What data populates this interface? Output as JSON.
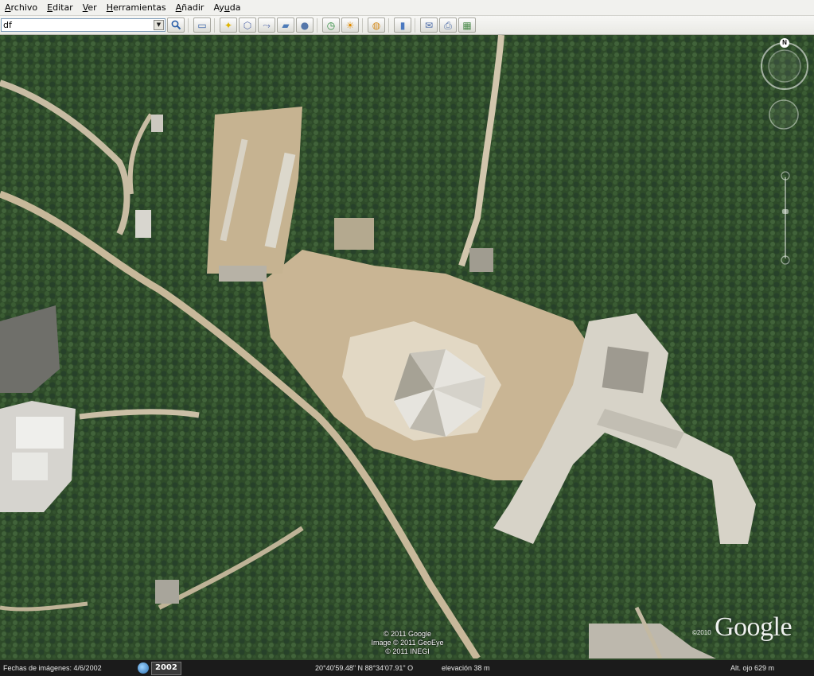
{
  "menu": {
    "items": [
      {
        "label": "Archivo",
        "mnemonic": "A"
      },
      {
        "label": "Editar",
        "mnemonic": "E"
      },
      {
        "label": "Ver",
        "mnemonic": "V"
      },
      {
        "label": "Herramientas",
        "mnemonic": "H"
      },
      {
        "label": "Añadir",
        "mnemonic": "A"
      },
      {
        "label": "Ayuda",
        "mnemonic": "u"
      }
    ]
  },
  "search": {
    "value": "df"
  },
  "toolbar": {
    "buttons": [
      {
        "name": "sidebar-toggle-icon",
        "glyph": "▭"
      },
      {
        "name": "add-placemark-icon",
        "glyph": "✦"
      },
      {
        "name": "add-polygon-icon",
        "glyph": "⬡"
      },
      {
        "name": "add-path-icon",
        "glyph": "⤳"
      },
      {
        "name": "add-image-overlay-icon",
        "glyph": "▰"
      },
      {
        "name": "record-tour-icon",
        "glyph": "●"
      },
      {
        "name": "historical-imagery-icon",
        "glyph": "◷"
      },
      {
        "name": "sunlight-icon",
        "glyph": "☀"
      },
      {
        "name": "planets-icon",
        "glyph": "◍"
      },
      {
        "name": "ruler-icon",
        "glyph": "▮"
      },
      {
        "name": "email-icon",
        "glyph": "✉"
      },
      {
        "name": "print-icon",
        "glyph": "⎙"
      },
      {
        "name": "view-in-maps-icon",
        "glyph": "▦"
      }
    ]
  },
  "nav": {
    "north_label": "N"
  },
  "map": {
    "copyright_lines": [
      "© 2011 Google",
      "Image © 2011 GeoEye",
      "© 2011 INEGI"
    ],
    "logo": "Google",
    "logo_year": "©2010"
  },
  "status": {
    "imagery_date": "Fechas de imágenes: 4/6/2002",
    "year": "2002",
    "coordinates": "20°40'59.48\" N   88°34'07.91\" O",
    "elevation": "elevación    38 m",
    "eye_alt": "Alt. ojo     629 m"
  }
}
